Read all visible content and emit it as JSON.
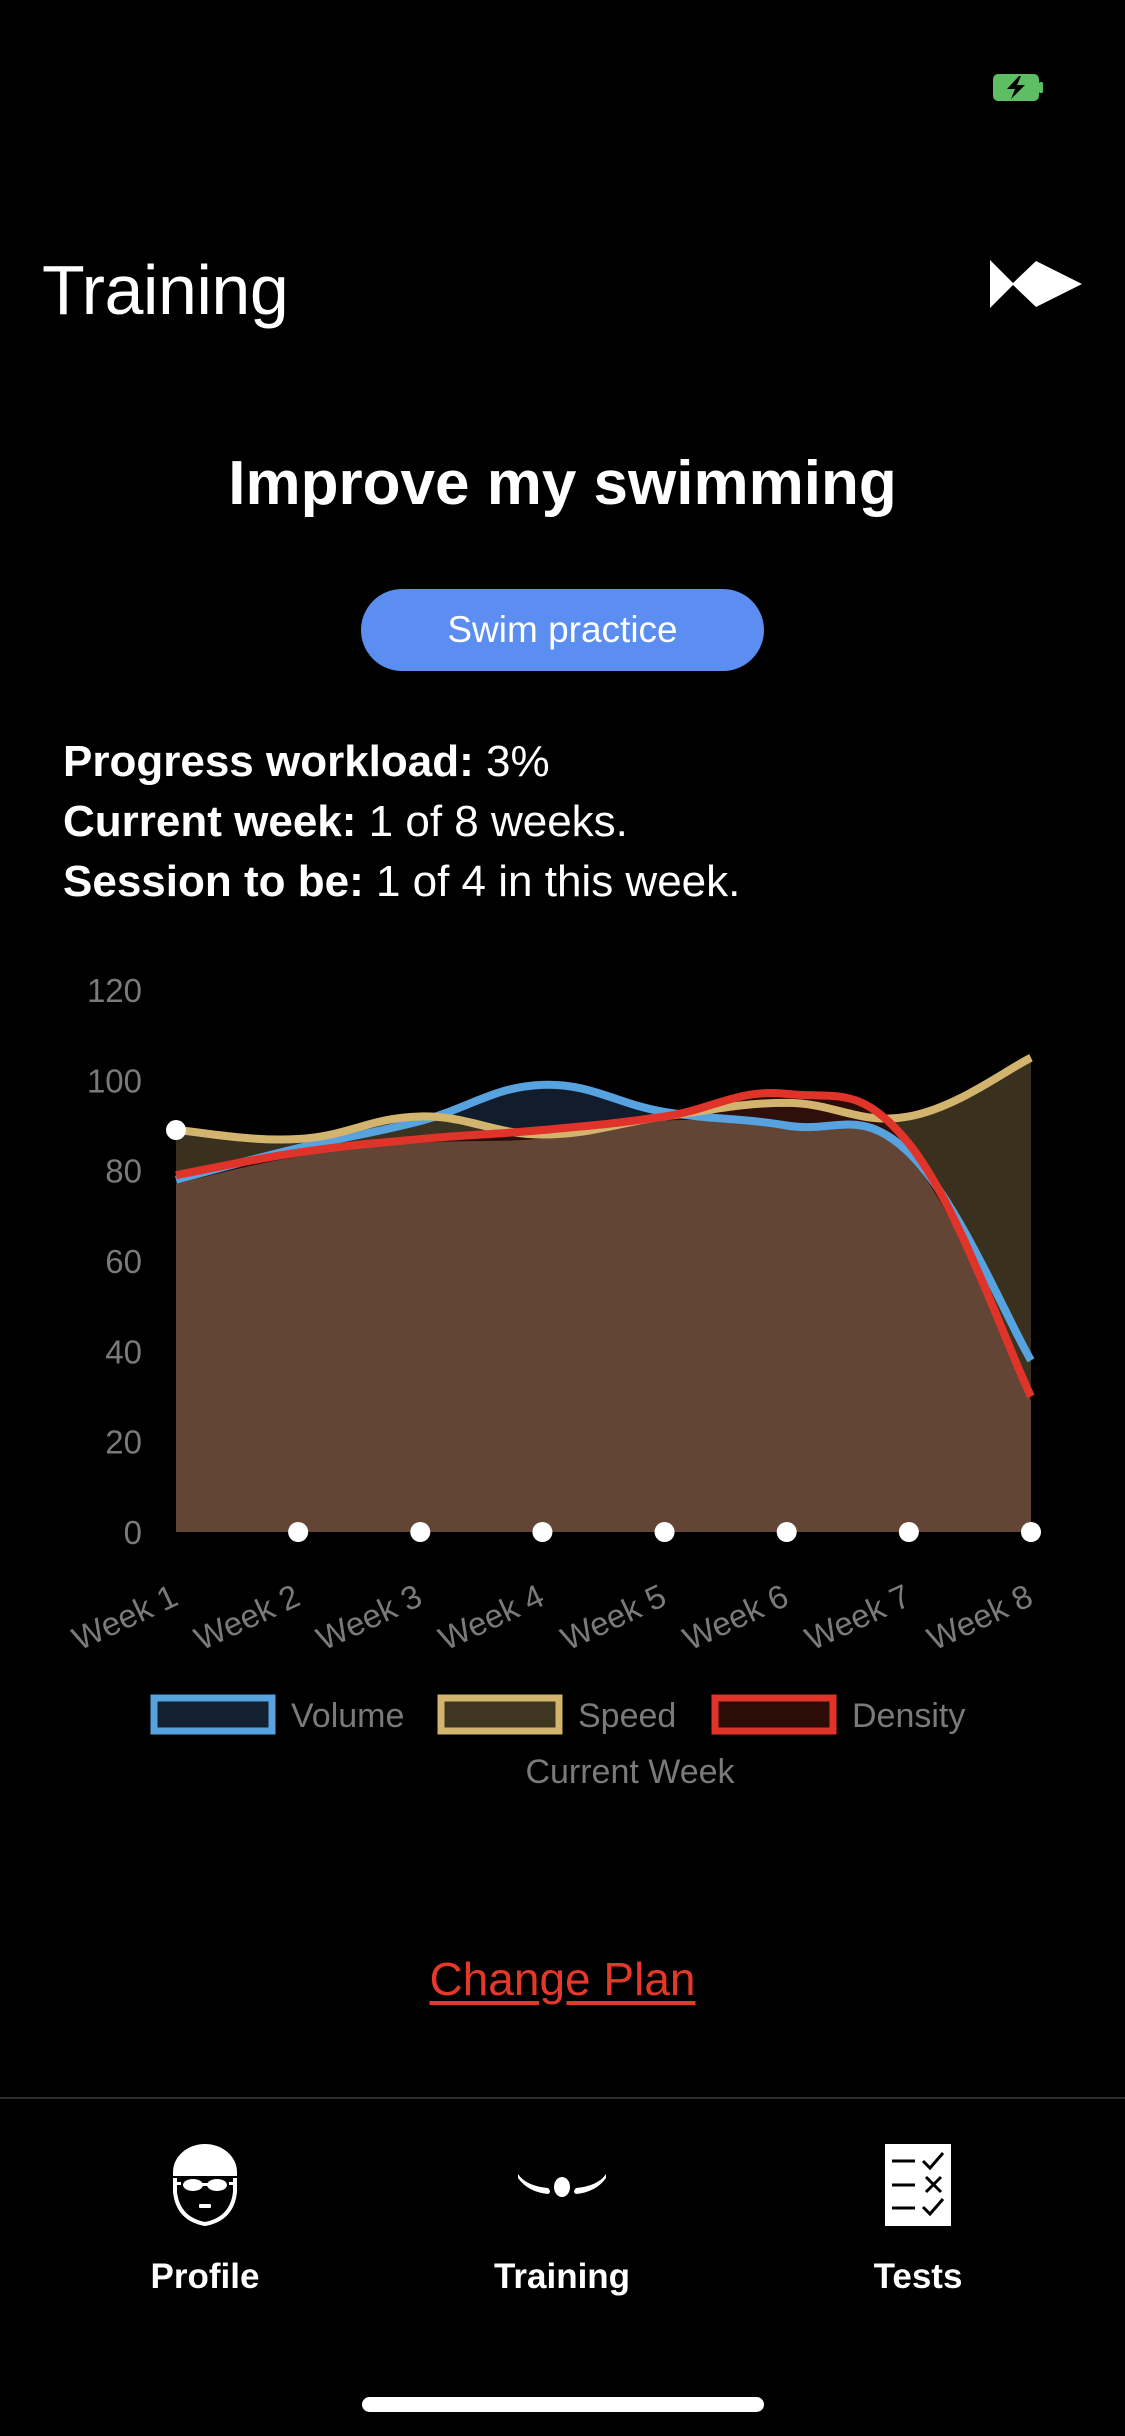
{
  "status_bar": {
    "battery_icon": "battery-charging-icon",
    "battery_color": "#5dbe63"
  },
  "header": {
    "title": "Training",
    "logo_icon": "fish-logo-icon"
  },
  "goal": {
    "title": "Improve my swimming",
    "button_label": "Swim practice",
    "button_color": "#5b8ef0"
  },
  "info": [
    {
      "label": "Progress workload:",
      "value": " 3%"
    },
    {
      "label": "Current week:",
      "value": " 1 of 8 weeks."
    },
    {
      "label": "Session to be:",
      "value": " 1 of 4 in this week."
    }
  ],
  "chart_data": {
    "type": "area",
    "categories": [
      "Week 1",
      "Week 2",
      "Week 3",
      "Week 4",
      "Week 5",
      "Week 6",
      "Week 7",
      "Week 8"
    ],
    "series": [
      {
        "name": "Volume",
        "color": "#56a3e0",
        "fill": "#132032",
        "values": [
          78,
          85,
          91,
          99,
          93,
          90,
          84,
          38
        ]
      },
      {
        "name": "Speed",
        "color": "#d2b46e",
        "fill": "#3f3621",
        "values": [
          89,
          87,
          92,
          88,
          92,
          95,
          92,
          105
        ]
      },
      {
        "name": "Density",
        "color": "#e0342a",
        "fill": "#2d0c08",
        "values": [
          79,
          84,
          87,
          89,
          92,
          97,
          86,
          30
        ]
      }
    ],
    "overlap_fill": "#634536",
    "yticks": [
      0,
      20,
      40,
      60,
      80,
      100,
      120
    ],
    "ylim": [
      0,
      120
    ],
    "xlabel": "Current Week",
    "ylabel": "",
    "current_week_index": 0,
    "legend_position": "bottom",
    "grid": false
  },
  "actions": {
    "change_plan": "Change Plan",
    "change_plan_color": "#e5372a"
  },
  "tabbar": [
    {
      "label": "Profile",
      "icon": "swimmer-head-icon"
    },
    {
      "label": "Training",
      "icon": "swimmer-stroke-icon"
    },
    {
      "label": "Tests",
      "icon": "checklist-icon"
    }
  ]
}
